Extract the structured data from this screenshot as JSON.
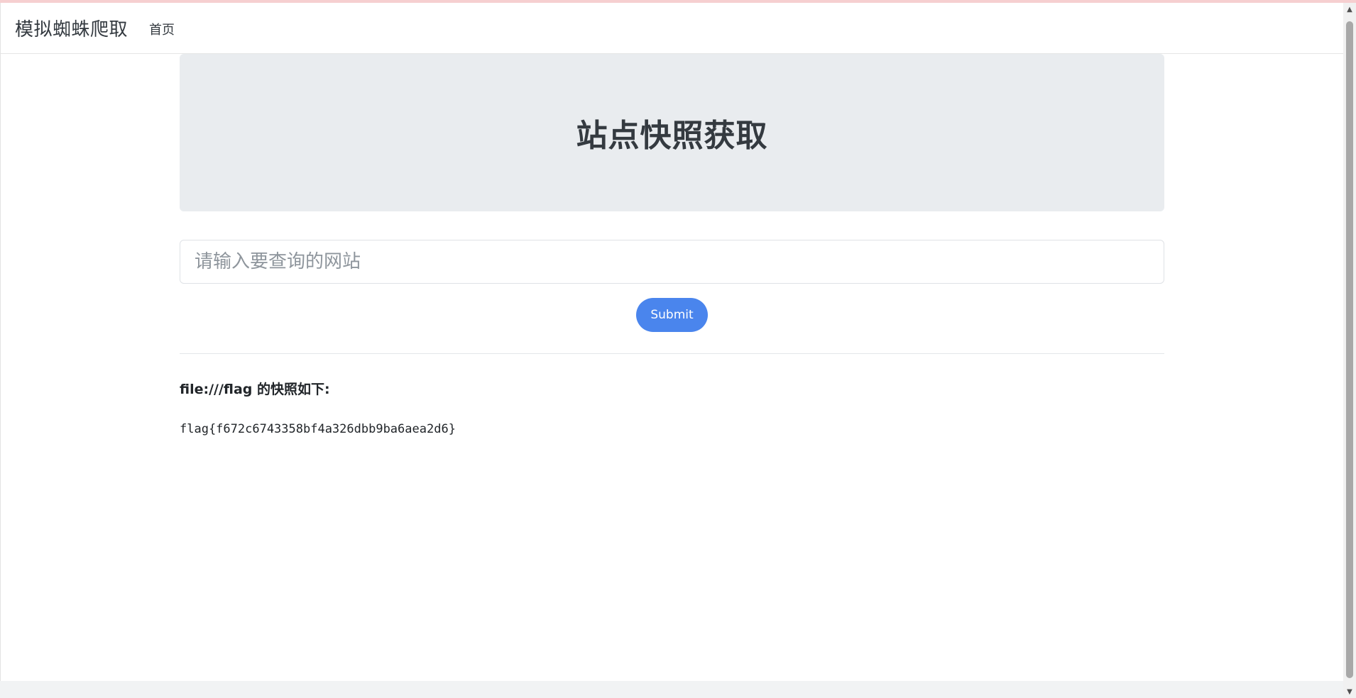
{
  "navbar": {
    "brand": "模拟蜘蛛爬取",
    "home_link": "首页"
  },
  "hero": {
    "title": "站点快照获取"
  },
  "form": {
    "url_placeholder": "请输入要查询的网站",
    "url_value": "",
    "submit_label": "Submit"
  },
  "result": {
    "heading": "file:///flag 的快照如下:",
    "content": "flag{f672c6743358bf4a326dbb9ba6aea2d6}"
  },
  "scrollbar": {
    "up_icon": "▲",
    "down_icon": "▼"
  },
  "colors": {
    "accent": "#4a85ed",
    "hero_bg": "#e9ecef"
  }
}
